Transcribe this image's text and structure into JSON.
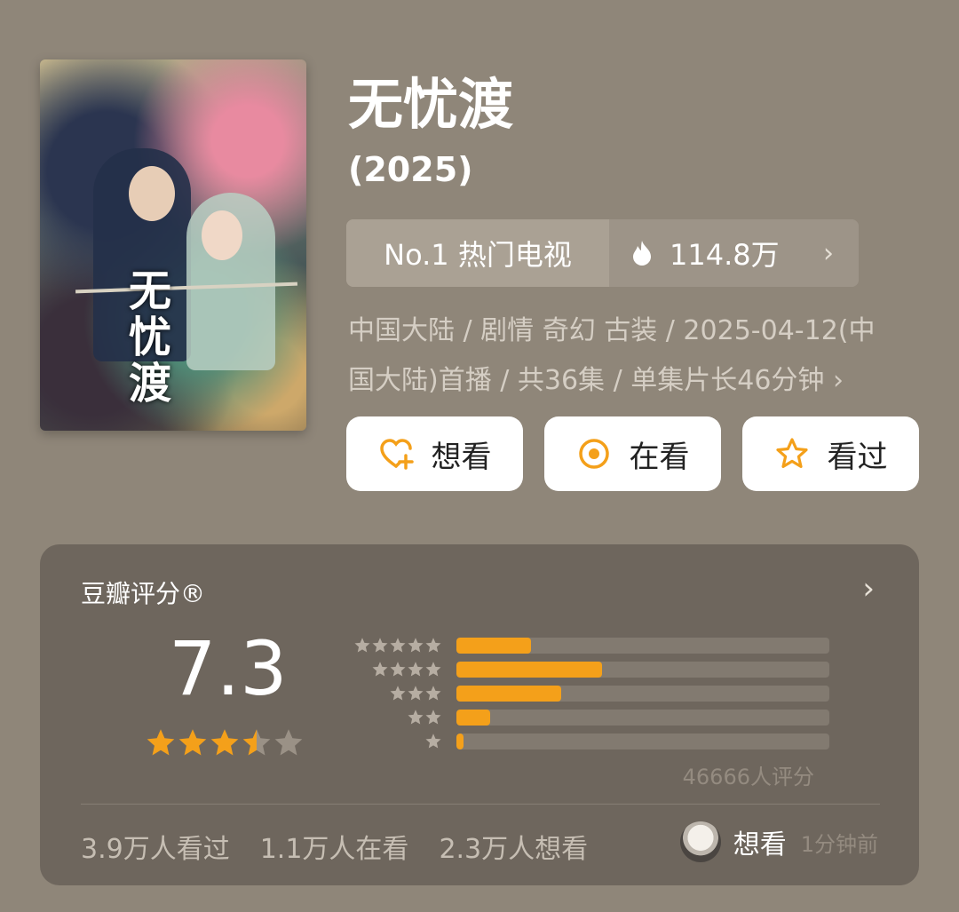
{
  "movie": {
    "title": "无忧渡",
    "year": "(2025)",
    "poster_title": "无忧渡"
  },
  "rank": {
    "label": "No.1 热门电视",
    "heat": "114.8万",
    "heat_icon": "flame-icon",
    "chevron": "›"
  },
  "meta": {
    "line1": "中国大陆 / 剧情 奇幻 古装 / 2025-04-12(中",
    "line2": "国大陆)首播 / 共36集 / 单集片长46分钟 ›"
  },
  "actions": [
    {
      "label": "想看",
      "icon": "heart-plus-icon"
    },
    {
      "label": "在看",
      "icon": "target-circle-icon"
    },
    {
      "label": "看过",
      "icon": "star-outline-icon"
    }
  ],
  "rating": {
    "title": "豆瓣评分®",
    "chevron": "›",
    "score": "7.3",
    "score_stars": 3.5,
    "distribution": [
      {
        "stars": 5,
        "fraction": 0.2
      },
      {
        "stars": 4,
        "fraction": 0.39
      },
      {
        "stars": 3,
        "fraction": 0.28
      },
      {
        "stars": 2,
        "fraction": 0.09
      },
      {
        "stars": 1,
        "fraction": 0.02
      }
    ],
    "count": "46666人评分",
    "stats": [
      "3.9万人看过",
      "1.1万人在看",
      "2.3万人想看"
    ],
    "latest_action": "想看",
    "latest_time": "1分钟前"
  },
  "colors": {
    "background": "#8f8679",
    "accent": "#f4a01a",
    "card": "#6e665d"
  }
}
